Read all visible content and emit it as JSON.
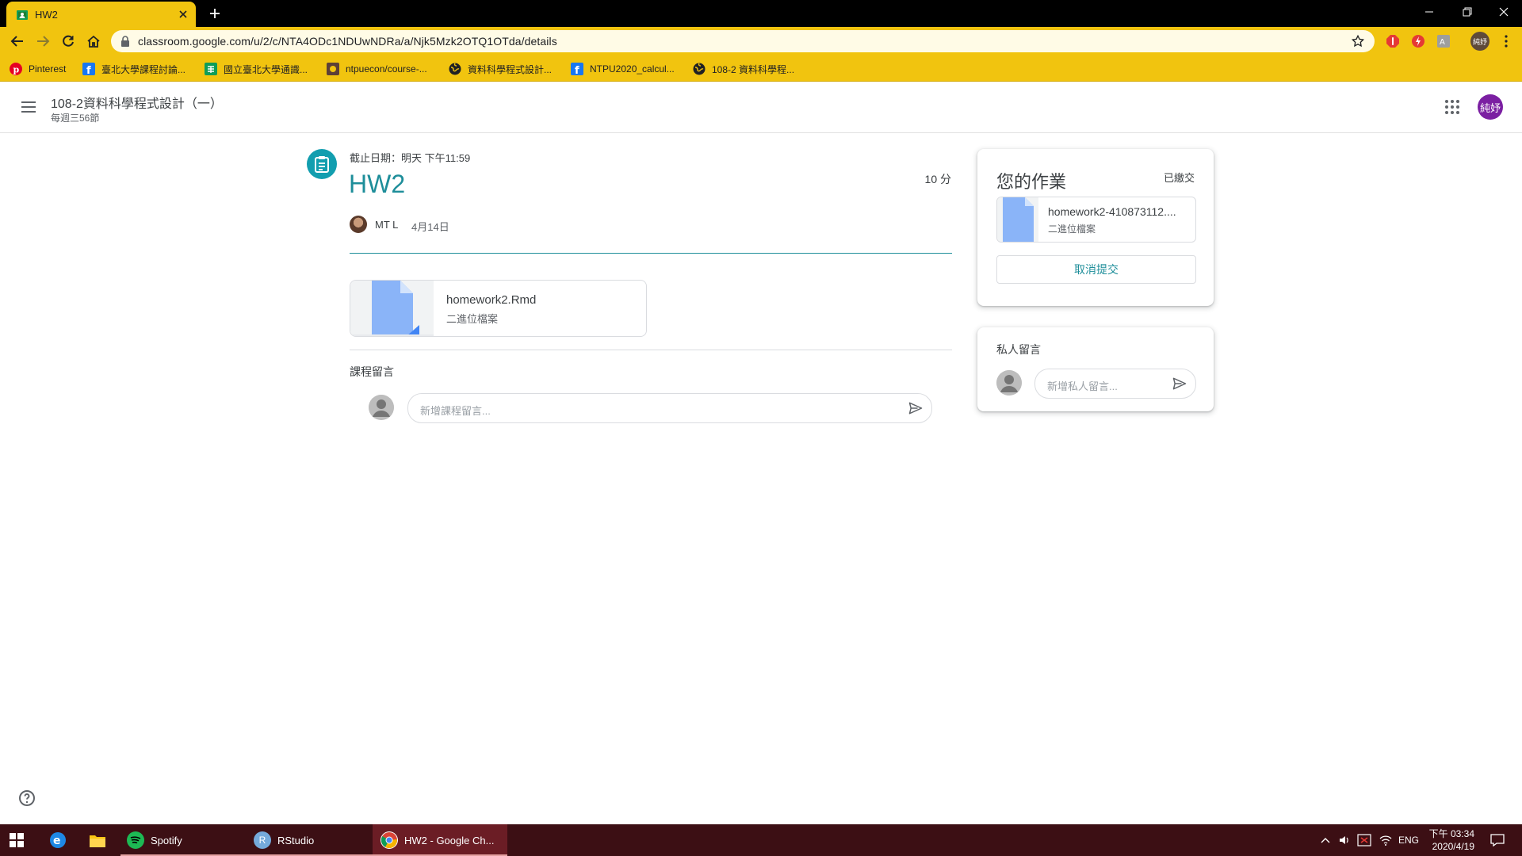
{
  "browser": {
    "tab_title": "HW2",
    "url": "classroom.google.com/u/2/c/NTA4ODc1NDUwNDRa/a/Njk5Mzk2OTQ1OTda/details",
    "profile_label": "純妤",
    "accent_color": "#f1c40f",
    "bookmarks": [
      {
        "label": "Pinterest",
        "icon": "pinterest-icon"
      },
      {
        "label": "臺北大學課程討論...",
        "icon": "facebook-icon"
      },
      {
        "label": "國立臺北大學通識...",
        "icon": "sheets-icon"
      },
      {
        "label": "ntpuecon/course-...",
        "icon": "github-icon"
      },
      {
        "label": "資料科學程式設計...",
        "icon": "globe-icon"
      },
      {
        "label": "NTPU2020_calcul...",
        "icon": "facebook-icon"
      },
      {
        "label": "108-2 資料科學程...",
        "icon": "globe-icon"
      }
    ]
  },
  "header": {
    "course_title": "108-2資料科學程式設計（一）",
    "course_subtitle": "每週三56節",
    "user_initials": "純妤"
  },
  "assignment": {
    "due": "截止日期：明天 下午11:59",
    "title": "HW2",
    "points": "10 分",
    "author": "MT L",
    "date": "4月14日",
    "attachment": {
      "name": "homework2.Rmd",
      "type": "二進位檔案"
    },
    "class_comments_label": "課程留言",
    "class_comment_placeholder": "新增課程留言..."
  },
  "your_work": {
    "title": "您的作業",
    "status": "已繳交",
    "file_name": "homework2-410873112....",
    "file_type": "二進位檔案",
    "unsubmit_label": "取消提交"
  },
  "private_comments": {
    "label": "私人留言",
    "placeholder": "新增私人留言..."
  },
  "taskbar": {
    "apps": [
      {
        "label": "Spotify"
      },
      {
        "label": "RStudio"
      },
      {
        "label": "HW2 - Google Ch..."
      }
    ],
    "language": "ENG",
    "time": "下午 03:34",
    "date": "2020/4/19"
  }
}
